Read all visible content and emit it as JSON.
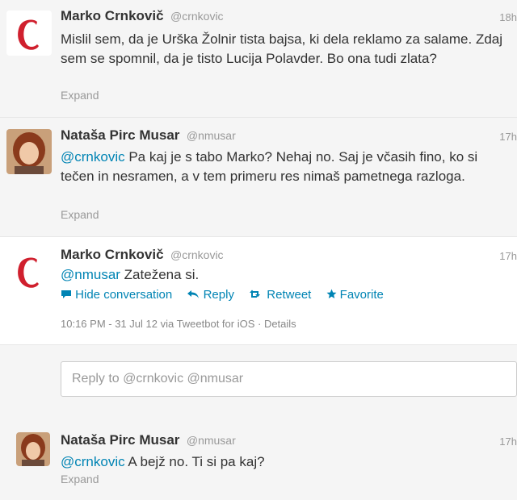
{
  "tweets": [
    {
      "name": "Marko Crnkovič",
      "handle": "@crnkovic",
      "time": "18h",
      "text": "Mislil sem, da je Urška Žolnir tista bajsa, ki dela reklamo za salame. Zdaj sem se spomnil, da je tisto Lucija Polavder. Bo ona tudi zlata?",
      "expand": "Expand"
    },
    {
      "name": "Nataša Pirc Musar",
      "handle": "@nmusar",
      "time": "17h",
      "mention": "@crnkovic",
      "text": " Pa kaj je s tabo Marko? Nehaj no. Saj je včasih fino, ko si tečen in nesramen, a v tem primeru res nimaš pametnega razloga.",
      "expand": "Expand"
    },
    {
      "name": "Marko Crnkovič",
      "handle": "@crnkovic",
      "time": "17h",
      "mention": "@nmusar",
      "text": " Zatežena si.",
      "actions": {
        "hide": "Hide conversation",
        "reply": "Reply",
        "retweet": "Retweet",
        "favorite": "Favorite"
      },
      "meta": "10:16 PM - 31 Jul 12 via Tweetbot for iOS · Details"
    },
    {
      "name": "Nataša Pirc Musar",
      "handle": "@nmusar",
      "time": "17h",
      "mention": "@crnkovic",
      "text": " A bejž no. Ti si pa kaj?",
      "expand": "Expand"
    }
  ],
  "reply": {
    "placeholder": "Reply to @crnkovic @nmusar"
  },
  "icons": {
    "hide": "speech-bubble-icon",
    "reply": "reply-arrow-icon",
    "retweet": "retweet-icon",
    "favorite": "star-icon"
  },
  "colors": {
    "link": "#0084b4",
    "logo_red": "#d0202e"
  }
}
